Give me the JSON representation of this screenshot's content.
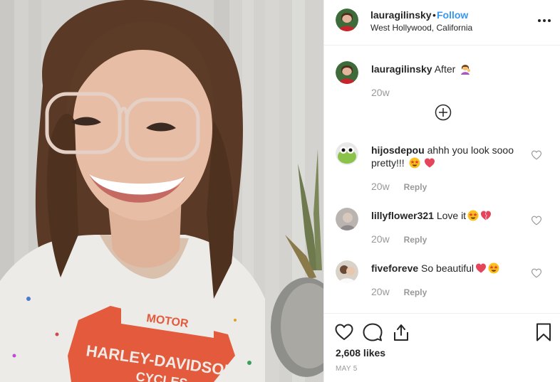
{
  "post": {
    "username": "lauragilinsky",
    "separator": "•",
    "follow_label": "Follow",
    "location": "West Hollywood, California"
  },
  "caption": {
    "username": "lauragilinsky",
    "text": "After",
    "emoji": "woman-tipping-hand-emoji",
    "time": "20w"
  },
  "comments": [
    {
      "username": "hijosdepou",
      "text": "ahhh you look sooo pretty!!!",
      "emojis": [
        "star-struck-emoji",
        "heart-emoji"
      ],
      "time": "20w",
      "reply_label": "Reply"
    },
    {
      "username": "lillyflower321",
      "text": "Love it",
      "emojis": [
        "star-struck-emoji",
        "broken-heart-emoji"
      ],
      "time": "20w",
      "reply_label": "Reply"
    },
    {
      "username": "fiveforeve",
      "text": "So beautiful",
      "emojis": [
        "heart-emoji",
        "star-struck-emoji"
      ],
      "time": "20w",
      "reply_label": "Reply"
    }
  ],
  "footer": {
    "likes": "2,608 likes",
    "date": "MAY 5"
  },
  "icons": {
    "more": "more-icon",
    "load_more": "plus-circle-icon",
    "like": "heart-icon",
    "comment": "comment-icon",
    "share": "share-icon",
    "save": "bookmark-icon"
  },
  "colors": {
    "follow": "#3897f0",
    "text": "#262626",
    "muted": "#999999",
    "border": "#efefef"
  },
  "photo": {
    "shirt_text_top": "MOTOR",
    "shirt_text_middle": "HARLEY-DAVIDSON",
    "shirt_text_bottom": "CYCLES"
  }
}
